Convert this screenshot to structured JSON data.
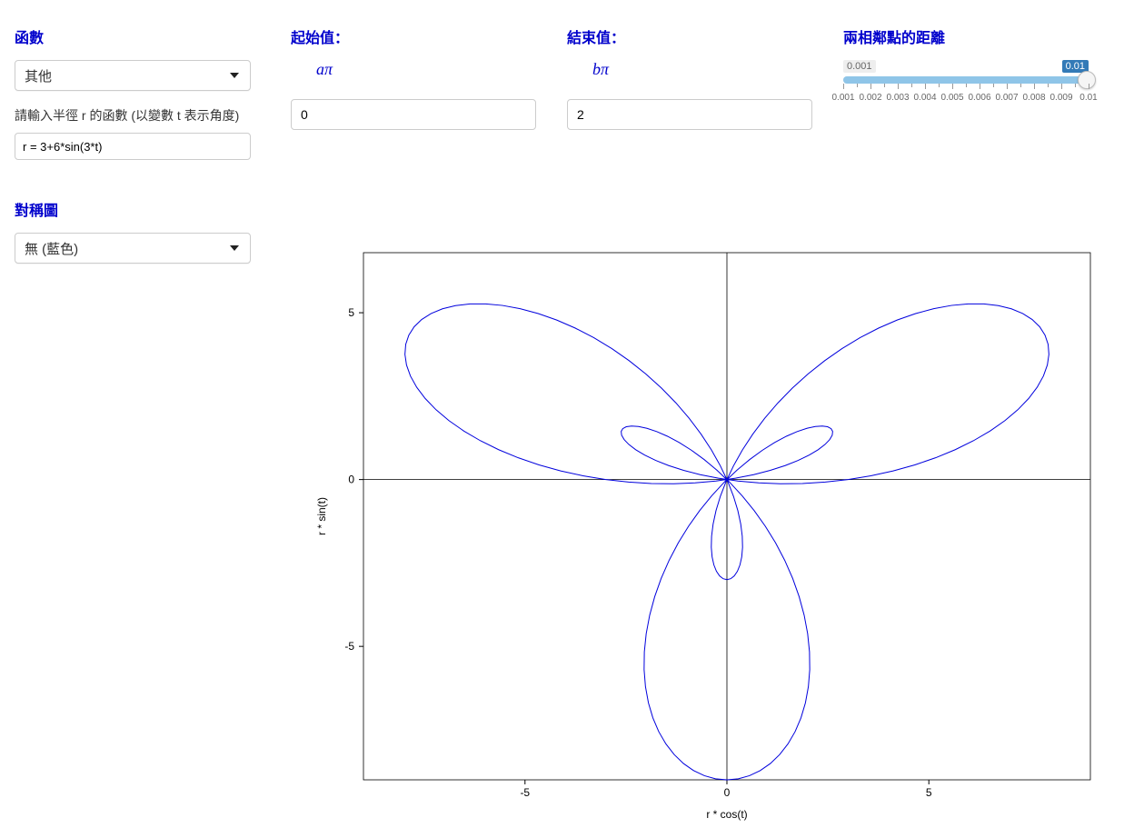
{
  "function_section": {
    "title": "函數",
    "select_value": "其他",
    "help_text": "請輸入半徑 r 的函數 (以變數 t 表示角度)",
    "input_value": "r = 3+6*sin(3*t)"
  },
  "start_section": {
    "title": "起始值：",
    "math_label": "aπ",
    "value": "0"
  },
  "end_section": {
    "title": "結束值：",
    "math_label": "bπ",
    "value": "2"
  },
  "distance_section": {
    "title": "兩相鄰點的距離",
    "min_label": "0.001",
    "max_label": "0.01",
    "current_value": 0.01,
    "tick_labels": [
      "0.001",
      "0.002",
      "0.003",
      "0.004",
      "0.005",
      "0.006",
      "0.007",
      "0.008",
      "0.009",
      "0.01"
    ]
  },
  "symmetry_section": {
    "title": "對稱圖",
    "select_value": "無 (藍色)"
  },
  "chart_data": {
    "type": "line",
    "formula": "r = 3 + 6*sin(3*t)",
    "parameter_range": {
      "from_times_pi": 0,
      "to_times_pi": 2
    },
    "step_fraction_of_pi": 0.01,
    "xlabel": "r * cos(t)",
    "ylabel": "r * sin(t)",
    "x_ticks": [
      -5,
      0,
      5
    ],
    "y_ticks": [
      -5,
      0,
      5
    ],
    "xlim": [
      -9,
      9
    ],
    "ylim": [
      -9,
      6.8
    ],
    "series": [
      {
        "name": "r=3+6*sin(3*t)",
        "color": "#0000dd",
        "description": "polar curve x=r*cos(t), y=r*sin(t), t∈[0,2π]"
      }
    ]
  }
}
